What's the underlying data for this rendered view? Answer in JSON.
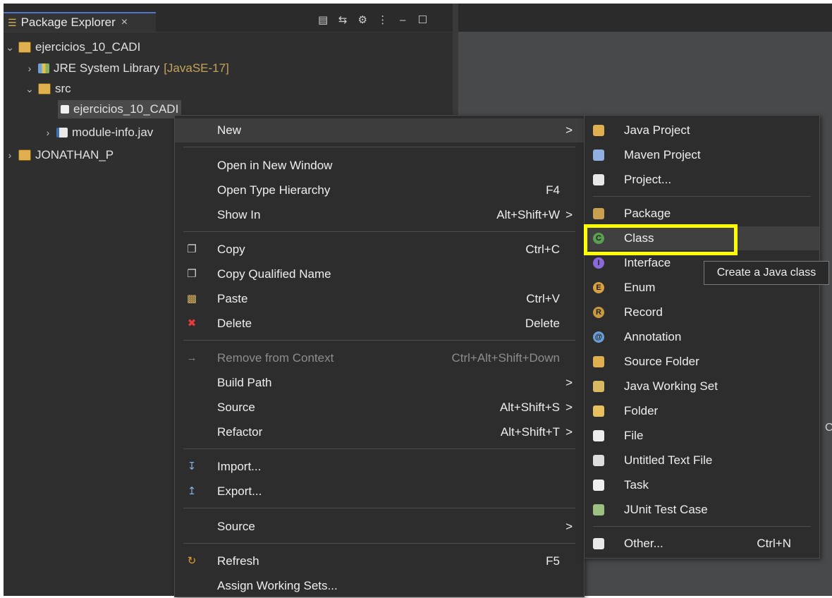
{
  "package_explorer": {
    "tab_title": "Package Explorer",
    "close_glyph": "×",
    "toolbar": [
      "▤",
      "⇆",
      "⚙",
      "⋮",
      "–",
      "☐"
    ]
  },
  "tree": {
    "project1": "ejercicios_10_CADI",
    "jre_label": "JRE System Library",
    "jre_version": "[JavaSE-17]",
    "src": "src",
    "package": "ejercicios_10_CADI",
    "module_file": "module-info.jav",
    "project2": "JONATHAN_P"
  },
  "context_menu": {
    "new": "New",
    "open_new_window": "Open in New Window",
    "open_type_hierarchy": "Open Type Hierarchy",
    "open_type_hierarchy_acc": "F4",
    "show_in": "Show In",
    "show_in_acc": "Alt+Shift+W",
    "copy": "Copy",
    "copy_acc": "Ctrl+C",
    "copy_qualified": "Copy Qualified Name",
    "paste": "Paste",
    "paste_acc": "Ctrl+V",
    "delete": "Delete",
    "delete_acc": "Delete",
    "remove_context": "Remove from Context",
    "remove_context_acc": "Ctrl+Alt+Shift+Down",
    "build_path": "Build Path",
    "source": "Source",
    "source_acc": "Alt+Shift+S",
    "refactor": "Refactor",
    "refactor_acc": "Alt+Shift+T",
    "import": "Import...",
    "export": "Export...",
    "source2": "Source",
    "refresh": "Refresh",
    "refresh_acc": "F5",
    "assign_working_sets": "Assign Working Sets...",
    "arrow": ">"
  },
  "new_submenu": {
    "java_project": "Java Project",
    "maven_project": "Maven Project",
    "project": "Project...",
    "package": "Package",
    "class": "Class",
    "interface": "Interface",
    "enum": "Enum",
    "record": "Record",
    "annotation": "Annotation",
    "source_folder": "Source Folder",
    "java_working_set": "Java Working Set",
    "folder": "Folder",
    "file": "File",
    "untitled_text_file": "Untitled Text File",
    "task": "Task",
    "junit_test_case": "JUnit Test Case",
    "other": "Other...",
    "other_acc": "Ctrl+N"
  },
  "tooltip": "Create a Java class",
  "edge_glyph": "C",
  "colors": {
    "highlight": "#ffff00",
    "background": "#2d2d2d",
    "accent": "#4d78cc"
  }
}
